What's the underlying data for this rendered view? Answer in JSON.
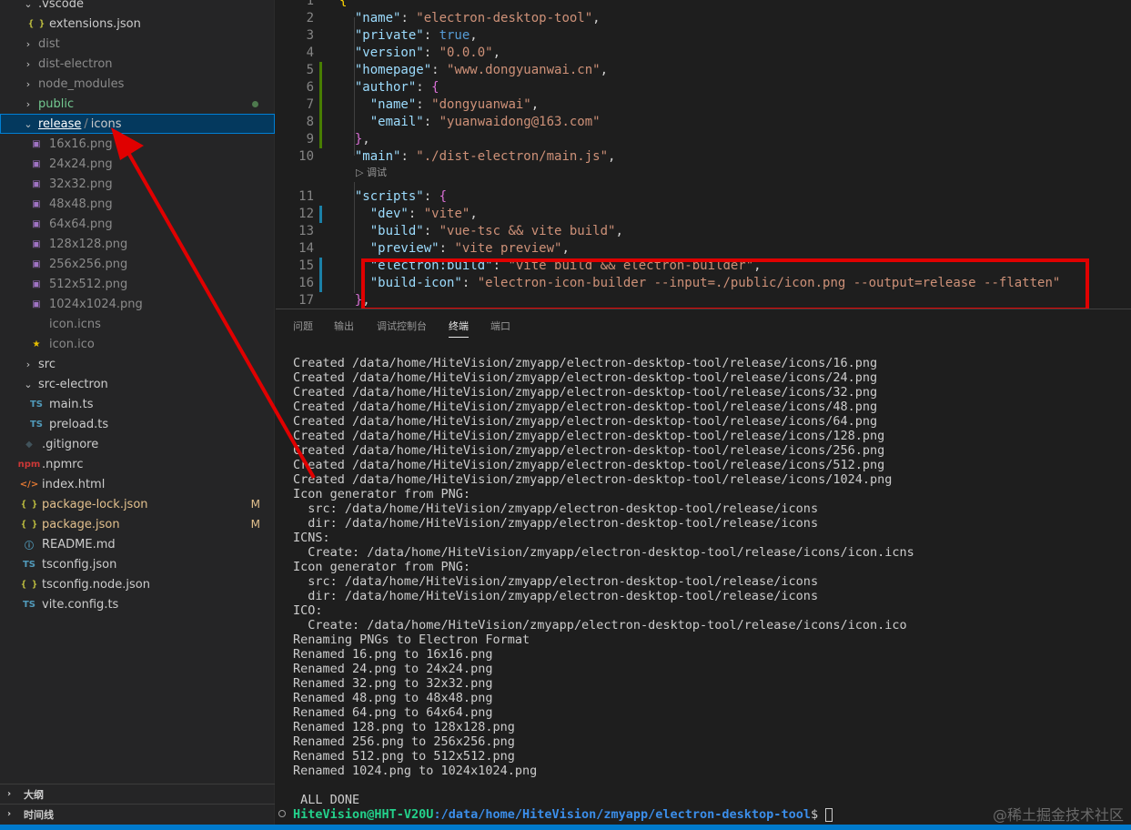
{
  "explorer": {
    "items": [
      {
        "label": ".vscode",
        "type": "folder",
        "open": true,
        "indent": 0,
        "icon": "chevron-down-icon"
      },
      {
        "label": "extensions.json",
        "type": "json",
        "indent": 1
      },
      {
        "label": "dist",
        "type": "folder",
        "open": false,
        "indent": 0,
        "dim": true
      },
      {
        "label": "dist-electron",
        "type": "folder",
        "open": false,
        "indent": 0,
        "dim": true
      },
      {
        "label": "node_modules",
        "type": "folder",
        "open": false,
        "indent": 0,
        "dim": true
      },
      {
        "label": "public",
        "type": "folder",
        "open": false,
        "indent": 0,
        "status": "green",
        "dot": true
      },
      {
        "label": "release",
        "type": "folder-selected",
        "open": true,
        "indent": 0,
        "crumb": "icons"
      },
      {
        "label": "16x16.png",
        "type": "img",
        "indent": 1,
        "dim": true
      },
      {
        "label": "24x24.png",
        "type": "img",
        "indent": 1,
        "dim": true
      },
      {
        "label": "32x32.png",
        "type": "img",
        "indent": 1,
        "dim": true
      },
      {
        "label": "48x48.png",
        "type": "img",
        "indent": 1,
        "dim": true
      },
      {
        "label": "64x64.png",
        "type": "img",
        "indent": 1,
        "dim": true
      },
      {
        "label": "128x128.png",
        "type": "img",
        "indent": 1,
        "dim": true
      },
      {
        "label": "256x256.png",
        "type": "img",
        "indent": 1,
        "dim": true
      },
      {
        "label": "512x512.png",
        "type": "img",
        "indent": 1,
        "dim": true
      },
      {
        "label": "1024x1024.png",
        "type": "img",
        "indent": 1,
        "dim": true
      },
      {
        "label": "icon.icns",
        "type": "blank",
        "indent": 1,
        "dim": true
      },
      {
        "label": "icon.ico",
        "type": "star",
        "indent": 1,
        "dim": true
      },
      {
        "label": "src",
        "type": "folder",
        "open": false,
        "indent": 0
      },
      {
        "label": "src-electron",
        "type": "folder",
        "open": true,
        "indent": 0
      },
      {
        "label": "main.ts",
        "type": "ts",
        "indent": 1
      },
      {
        "label": "preload.ts",
        "type": "ts",
        "indent": 1
      },
      {
        "label": ".gitignore",
        "type": "git",
        "indent": 0
      },
      {
        "label": ".npmrc",
        "type": "npm",
        "indent": 0
      },
      {
        "label": "index.html",
        "type": "html",
        "indent": 0
      },
      {
        "label": "package-lock.json",
        "type": "json",
        "indent": 0,
        "status": "yellow",
        "badge": "M"
      },
      {
        "label": "package.json",
        "type": "json",
        "indent": 0,
        "status": "yellow",
        "badge": "M"
      },
      {
        "label": "README.md",
        "type": "info",
        "indent": 0
      },
      {
        "label": "tsconfig.json",
        "type": "ts-file",
        "indent": 0
      },
      {
        "label": "tsconfig.node.json",
        "type": "json",
        "indent": 0
      },
      {
        "label": "vite.config.ts",
        "type": "ts",
        "indent": 0
      }
    ],
    "outline_label": "大纲",
    "timeline_label": "时间线"
  },
  "editor": {
    "codelens": "调试",
    "lines": [
      {
        "n": "1",
        "tokens": [
          [
            "br",
            "{"
          ]
        ]
      },
      {
        "n": "2",
        "tokens": [
          [
            "p",
            "  "
          ],
          [
            "k",
            "\"name\""
          ],
          [
            "p",
            ": "
          ],
          [
            "s",
            "\"electron-desktop-tool\""
          ],
          [
            "p",
            ","
          ]
        ]
      },
      {
        "n": "3",
        "tokens": [
          [
            "p",
            "  "
          ],
          [
            "k",
            "\"private\""
          ],
          [
            "p",
            ": "
          ],
          [
            "b",
            "true"
          ],
          [
            "p",
            ","
          ]
        ]
      },
      {
        "n": "4",
        "tokens": [
          [
            "p",
            "  "
          ],
          [
            "k",
            "\"version\""
          ],
          [
            "p",
            ": "
          ],
          [
            "s",
            "\"0.0.0\""
          ],
          [
            "p",
            ","
          ]
        ]
      },
      {
        "n": "5",
        "gutter": "green",
        "tokens": [
          [
            "p",
            "  "
          ],
          [
            "k",
            "\"homepage\""
          ],
          [
            "p",
            ": "
          ],
          [
            "s",
            "\"www.dongyuanwai.cn\""
          ],
          [
            "p",
            ","
          ]
        ]
      },
      {
        "n": "6",
        "gutter": "green",
        "tokens": [
          [
            "p",
            "  "
          ],
          [
            "k",
            "\"author\""
          ],
          [
            "p",
            ": "
          ],
          [
            "br2",
            "{"
          ]
        ]
      },
      {
        "n": "7",
        "gutter": "green",
        "tokens": [
          [
            "p",
            "    "
          ],
          [
            "k",
            "\"name\""
          ],
          [
            "p",
            ": "
          ],
          [
            "s",
            "\"dongyuanwai\""
          ],
          [
            "p",
            ","
          ]
        ]
      },
      {
        "n": "8",
        "gutter": "green",
        "tokens": [
          [
            "p",
            "    "
          ],
          [
            "k",
            "\"email\""
          ],
          [
            "p",
            ": "
          ],
          [
            "s",
            "\"yuanwaidong@163.com\""
          ]
        ]
      },
      {
        "n": "9",
        "gutter": "green",
        "tokens": [
          [
            "p",
            "  "
          ],
          [
            "br2",
            "}"
          ],
          [
            "p",
            ","
          ]
        ]
      },
      {
        "n": "10",
        "tokens": [
          [
            "p",
            "  "
          ],
          [
            "k",
            "\"main\""
          ],
          [
            "p",
            ": "
          ],
          [
            "s",
            "\"./dist-electron/main.js\""
          ],
          [
            "p",
            ","
          ]
        ]
      },
      {
        "n": "11",
        "tokens": [
          [
            "p",
            "  "
          ],
          [
            "k",
            "\"scripts\""
          ],
          [
            "p",
            ": "
          ],
          [
            "br2",
            "{"
          ]
        ]
      },
      {
        "n": "12",
        "gutter": "blue",
        "tokens": [
          [
            "p",
            "    "
          ],
          [
            "k",
            "\"dev\""
          ],
          [
            "p",
            ": "
          ],
          [
            "s",
            "\"vite\""
          ],
          [
            "p",
            ","
          ]
        ]
      },
      {
        "n": "13",
        "tokens": [
          [
            "p",
            "    "
          ],
          [
            "k",
            "\"build\""
          ],
          [
            "p",
            ": "
          ],
          [
            "s",
            "\"vue-tsc && vite build\""
          ],
          [
            "p",
            ","
          ]
        ]
      },
      {
        "n": "14",
        "tokens": [
          [
            "p",
            "    "
          ],
          [
            "k",
            "\"preview\""
          ],
          [
            "p",
            ": "
          ],
          [
            "s",
            "\"vite preview\""
          ],
          [
            "p",
            ","
          ]
        ]
      },
      {
        "n": "15",
        "gutter": "blue",
        "tokens": [
          [
            "p",
            "    "
          ],
          [
            "k",
            "\"electron:build\""
          ],
          [
            "p",
            ": "
          ],
          [
            "s",
            "\"vite build && electron-builder\""
          ],
          [
            "p",
            ","
          ]
        ]
      },
      {
        "n": "16",
        "gutter": "blue",
        "tokens": [
          [
            "p",
            "    "
          ],
          [
            "k",
            "\"build-icon\""
          ],
          [
            "p",
            ": "
          ],
          [
            "s",
            "\"electron-icon-builder --input=./public/icon.png --output=release --flatten\""
          ]
        ]
      },
      {
        "n": "17",
        "tokens": [
          [
            "p",
            "  "
          ],
          [
            "br2",
            "}"
          ],
          [
            "p",
            ","
          ]
        ]
      }
    ]
  },
  "panel": {
    "tabs": [
      {
        "label": "问题",
        "active": false
      },
      {
        "label": "输出",
        "active": false
      },
      {
        "label": "调试控制台",
        "active": false
      },
      {
        "label": "终端",
        "active": true
      },
      {
        "label": "端口",
        "active": false
      }
    ],
    "terminal_lines": [
      "Created /data/home/HiteVision/zmyapp/electron-desktop-tool/release/icons/16.png",
      "Created /data/home/HiteVision/zmyapp/electron-desktop-tool/release/icons/24.png",
      "Created /data/home/HiteVision/zmyapp/electron-desktop-tool/release/icons/32.png",
      "Created /data/home/HiteVision/zmyapp/electron-desktop-tool/release/icons/48.png",
      "Created /data/home/HiteVision/zmyapp/electron-desktop-tool/release/icons/64.png",
      "Created /data/home/HiteVision/zmyapp/electron-desktop-tool/release/icons/128.png",
      "Created /data/home/HiteVision/zmyapp/electron-desktop-tool/release/icons/256.png",
      "Created /data/home/HiteVision/zmyapp/electron-desktop-tool/release/icons/512.png",
      "Created /data/home/HiteVision/zmyapp/electron-desktop-tool/release/icons/1024.png",
      "Icon generator from PNG:",
      "  src: /data/home/HiteVision/zmyapp/electron-desktop-tool/release/icons",
      "  dir: /data/home/HiteVision/zmyapp/electron-desktop-tool/release/icons",
      "ICNS:",
      "  Create: /data/home/HiteVision/zmyapp/electron-desktop-tool/release/icons/icon.icns",
      "Icon generator from PNG:",
      "  src: /data/home/HiteVision/zmyapp/electron-desktop-tool/release/icons",
      "  dir: /data/home/HiteVision/zmyapp/electron-desktop-tool/release/icons",
      "ICO:",
      "  Create: /data/home/HiteVision/zmyapp/electron-desktop-tool/release/icons/icon.ico",
      "Renaming PNGs to Electron Format",
      "Renamed 16.png to 16x16.png",
      "Renamed 24.png to 24x24.png",
      "Renamed 32.png to 32x32.png",
      "Renamed 48.png to 48x48.png",
      "Renamed 64.png to 64x64.png",
      "Renamed 128.png to 128x128.png",
      "Renamed 256.png to 256x256.png",
      "Renamed 512.png to 512x512.png",
      "Renamed 1024.png to 1024x1024.png",
      "",
      " ALL DONE"
    ],
    "prompt_user": "HiteVision@HHT-V20U",
    "prompt_path": ":/data/home/HiteVision/zmyapp/electron-desktop-tool",
    "prompt_symbol": "$ "
  },
  "watermark": "@稀土掘金技术社区",
  "colors": {
    "accent": "#007acc",
    "annotation_red": "#e00000",
    "modified": "#e2c08d",
    "added": "#73c991"
  }
}
